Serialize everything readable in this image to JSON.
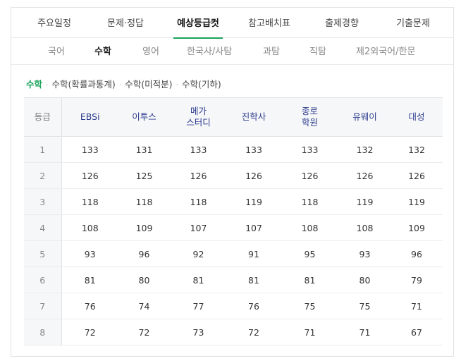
{
  "tabs": [
    {
      "label": "주요일정",
      "active": false
    },
    {
      "label": "문제·정답",
      "active": false
    },
    {
      "label": "예상등급컷",
      "active": true
    },
    {
      "label": "참고배치표",
      "active": false
    },
    {
      "label": "출제경향",
      "active": false
    },
    {
      "label": "기출문제",
      "active": false
    }
  ],
  "subjects": [
    {
      "label": "국어",
      "active": false
    },
    {
      "label": "수학",
      "active": true
    },
    {
      "label": "영어",
      "active": false
    },
    {
      "label": "한국사/사탐",
      "active": false
    },
    {
      "label": "과탐",
      "active": false
    },
    {
      "label": "직탐",
      "active": false
    },
    {
      "label": "제2외국어/한문",
      "active": false
    }
  ],
  "sub_filters": [
    {
      "label": "수학",
      "active": true
    },
    {
      "label": "수학(확률과통계)",
      "active": false
    },
    {
      "label": "수학(미적분)",
      "active": false
    },
    {
      "label": "수학(기하)",
      "active": false
    }
  ],
  "table": {
    "grade_header": "등급",
    "providers": [
      {
        "line1": "EBSi",
        "line2": ""
      },
      {
        "line1": "이투스",
        "line2": ""
      },
      {
        "line1": "메가",
        "line2": "스터디"
      },
      {
        "line1": "진학사",
        "line2": ""
      },
      {
        "line1": "종로",
        "line2": "학원"
      },
      {
        "line1": "유웨이",
        "line2": ""
      },
      {
        "line1": "대성",
        "line2": ""
      }
    ],
    "rows": [
      {
        "grade": "1",
        "values": [
          "133",
          "131",
          "133",
          "133",
          "133",
          "132",
          "132"
        ]
      },
      {
        "grade": "2",
        "values": [
          "126",
          "125",
          "126",
          "126",
          "126",
          "126",
          "126"
        ]
      },
      {
        "grade": "3",
        "values": [
          "118",
          "118",
          "118",
          "119",
          "118",
          "119",
          "119"
        ]
      },
      {
        "grade": "4",
        "values": [
          "108",
          "109",
          "107",
          "107",
          "108",
          "108",
          "109"
        ]
      },
      {
        "grade": "5",
        "values": [
          "93",
          "96",
          "92",
          "91",
          "95",
          "93",
          "96"
        ]
      },
      {
        "grade": "6",
        "values": [
          "81",
          "80",
          "81",
          "81",
          "81",
          "80",
          "79"
        ]
      },
      {
        "grade": "7",
        "values": [
          "76",
          "74",
          "77",
          "76",
          "75",
          "75",
          "71"
        ]
      },
      {
        "grade": "8",
        "values": [
          "72",
          "72",
          "73",
          "72",
          "71",
          "71",
          "67"
        ]
      }
    ]
  },
  "colors": {
    "accent": "#19a35a",
    "header_text": "#2b3a8c"
  }
}
